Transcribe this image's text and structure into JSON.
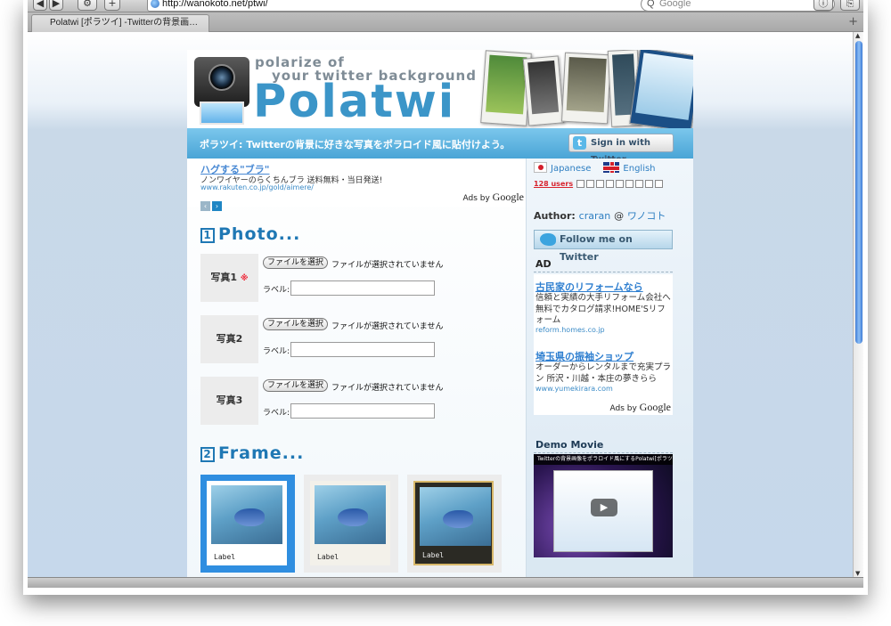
{
  "browser": {
    "url": "http://wanokoto.net/ptwi/",
    "search_placeholder": "Google",
    "tab_title": "Polatwi [ポラツイ] -Twitterの背景画…",
    "new_tab_symbol": "+"
  },
  "header": {
    "tagline_line1": "polarize of",
    "tagline_line2": "your twitter background",
    "logo": "Polatwi",
    "banner_text": "ポラツイ: Twitterの背景に好きな写真をポラロイド風に貼付けよう。",
    "signin_label": "Sign in with Twitter"
  },
  "top_ad": {
    "title": "ハグする\"ブラ\"",
    "description": "ノンワイヤーのらくちんブラ 送料無料・当日発送!",
    "url": "www.rakuten.co.jp/gold/aimere/",
    "ads_by": "Ads by",
    "google": "Google"
  },
  "photo_section": {
    "number": "1",
    "title": "Photo...",
    "rows": [
      {
        "label": "写真1",
        "required_mark": "※",
        "file_button": "ファイルを選択",
        "file_status": "ファイルが選択されていません",
        "label_field": "ラベル:"
      },
      {
        "label": "写真2",
        "required_mark": "",
        "file_button": "ファイルを選択",
        "file_status": "ファイルが選択されていません",
        "label_field": "ラベル:"
      },
      {
        "label": "写真3",
        "required_mark": "",
        "file_button": "ファイルを選択",
        "file_status": "ファイルが選択されていません",
        "label_field": "ラベル:"
      }
    ]
  },
  "frame_section": {
    "number": "2",
    "title": "Frame...",
    "frames": [
      {
        "caption": "Label",
        "selected": true
      },
      {
        "caption": "Label",
        "selected": false
      },
      {
        "caption": "Label",
        "selected": false
      }
    ]
  },
  "sidebar": {
    "lang_japanese": "Japanese",
    "lang_english": "English",
    "users_count": "128 users",
    "author_label": "Author:",
    "author_name": "craran",
    "author_at": "@",
    "author_site": "ワノコト",
    "follow_label": "Follow me on Twitter",
    "ad_heading": "AD",
    "ads": [
      {
        "title": "古民家のリフォームなら",
        "description": "信頼と実績の大手リフォーム会社へ無料でカタログ請求!HOME'Sリフォーム",
        "url": "reform.homes.co.jp"
      },
      {
        "title": "埼玉県の振袖ショップ",
        "description": "オーダーからレンタルまで充実プラン 所沢・川越・本庄の夢きらら",
        "url": "www.yumekirara.com"
      }
    ],
    "ads_by": "Ads by",
    "google": "Google",
    "demo_heading": "Demo Movie",
    "video_title": "Twitterの背景画像をポラロイド風にするPolatwi[ポラツイ]..."
  },
  "colors": {
    "accent_blue": "#3b95c8",
    "banner_blue": "#4aa5d6",
    "selected_frame": "#2f8ee0",
    "required_red": "#e23333"
  }
}
